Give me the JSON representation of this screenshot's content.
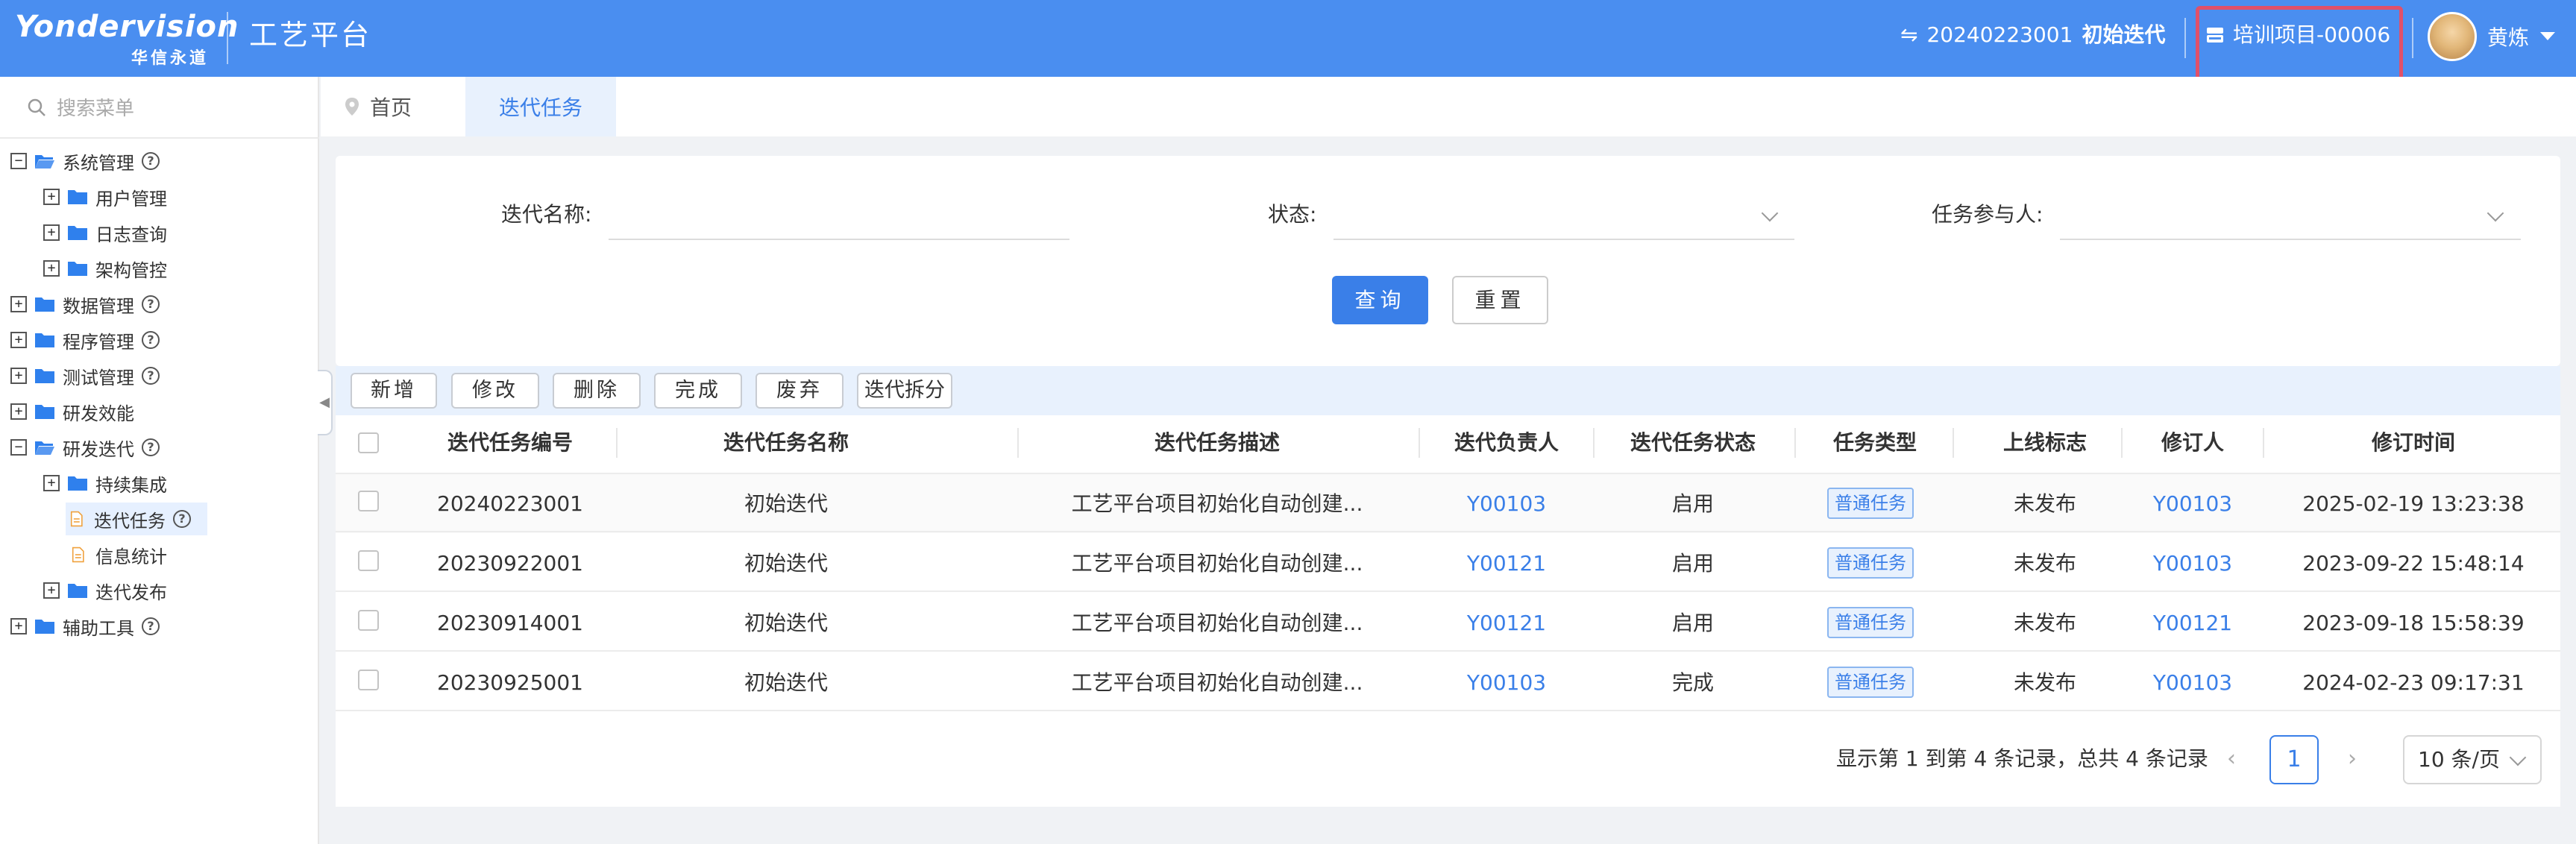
{
  "header": {
    "logo_text": "Yondervision",
    "logo_sub": "华信永道",
    "app_title": "工艺平台",
    "iteration_id": "20240223001",
    "iteration_name": "初始迭代",
    "project": "培训项目-00006",
    "user_name": "黄炼"
  },
  "sidebar": {
    "search_placeholder": "搜索菜单",
    "items": [
      {
        "label": "系统管理",
        "toggle": "−",
        "open": true,
        "help": true
      },
      {
        "label": "用户管理",
        "toggle": "+"
      },
      {
        "label": "日志查询",
        "toggle": "+"
      },
      {
        "label": "架构管控",
        "toggle": "+"
      },
      {
        "label": "数据管理",
        "toggle": "+",
        "help": true
      },
      {
        "label": "程序管理",
        "toggle": "+",
        "help": true
      },
      {
        "label": "测试管理",
        "toggle": "+",
        "help": true
      },
      {
        "label": "研发效能",
        "toggle": "+"
      },
      {
        "label": "研发迭代",
        "toggle": "−",
        "open": true,
        "help": true
      },
      {
        "label": "持续集成",
        "toggle": "+"
      },
      {
        "label": "迭代任务",
        "active": true,
        "help": true
      },
      {
        "label": "信息统计"
      },
      {
        "label": "迭代发布",
        "toggle": "+"
      },
      {
        "label": "辅助工具",
        "toggle": "+",
        "help": true
      }
    ]
  },
  "tabs": [
    {
      "label": "首页"
    },
    {
      "label": "迭代任务",
      "active": true
    }
  ],
  "filter": {
    "name_label": "迭代名称:",
    "status_label": "状态:",
    "participant_label": "任务参与人:",
    "query_button": "查询",
    "reset_button": "重置"
  },
  "toolbar": {
    "add": "新增",
    "edit": "修改",
    "delete": "删除",
    "complete": "完成",
    "discard": "废弃",
    "split": "迭代拆分"
  },
  "table": {
    "columns": [
      "迭代任务编号",
      "迭代任务名称",
      "迭代任务描述",
      "迭代负责人",
      "迭代任务状态",
      "任务类型",
      "上线标志",
      "修订人",
      "修订时间"
    ],
    "rows": [
      [
        "20240223001",
        "初始迭代",
        "工艺平台项目初始化自动创建...",
        "Y00103",
        "启用",
        "普通任务",
        "未发布",
        "Y00103",
        "2025-02-19 13:23:38"
      ],
      [
        "20230922001",
        "初始迭代",
        "工艺平台项目初始化自动创建...",
        "Y00121",
        "启用",
        "普通任务",
        "未发布",
        "Y00103",
        "2023-09-22 15:48:14"
      ],
      [
        "20230914001",
        "初始迭代",
        "工艺平台项目初始化自动创建...",
        "Y00121",
        "启用",
        "普通任务",
        "未发布",
        "Y00121",
        "2023-09-18 15:58:39"
      ],
      [
        "20230925001",
        "初始迭代",
        "工艺平台项目初始化自动创建...",
        "Y00103",
        "完成",
        "普通任务",
        "未发布",
        "Y00103",
        "2024-02-23 09:17:31"
      ]
    ]
  },
  "pagination": {
    "summary": "显示第 1 到第 4 条记录，总共 4 条记录",
    "prev": "‹",
    "next": "›",
    "current_page": "1",
    "page_size": "10 条/页"
  },
  "colors": {
    "header_bg": "#4a8ef0",
    "primary": "#3a7fe8",
    "highlight_border": "#e0506a",
    "folder_blue": "#2f80ed",
    "file_orange": "#f0a13c"
  }
}
